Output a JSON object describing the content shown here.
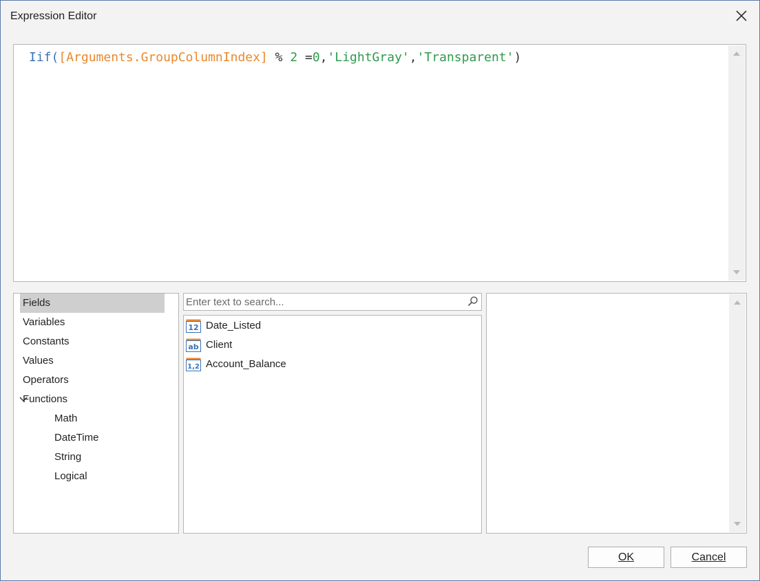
{
  "window": {
    "title": "Expression Editor"
  },
  "editor": {
    "tokens": {
      "fn": "Iif(",
      "field": "[Arguments.GroupColumnIndex]",
      "op1": " % ",
      "num1": "2",
      "op2": " =",
      "num2": "0",
      "comma1": ",",
      "str1": "'LightGray'",
      "comma2": ",",
      "str2": "'Transparent'",
      "close": ")"
    }
  },
  "categories": [
    {
      "label": "Fields",
      "selected": true
    },
    {
      "label": "Variables"
    },
    {
      "label": "Constants"
    },
    {
      "label": "Values"
    },
    {
      "label": "Operators"
    },
    {
      "label": "Functions",
      "expanded": true
    },
    {
      "label": "Math"
    },
    {
      "label": "DateTime"
    },
    {
      "label": "String"
    },
    {
      "label": "Logical"
    }
  ],
  "search": {
    "placeholder": "Enter text to search..."
  },
  "fields": [
    {
      "label": "Date_Listed",
      "icon_text": "12",
      "icon": "number-field-icon"
    },
    {
      "label": "Client",
      "icon_text": "ab",
      "icon": "string-field-icon"
    },
    {
      "label": "Account_Balance",
      "icon_text": "1,2",
      "icon": "decimal-field-icon"
    }
  ],
  "buttons": {
    "ok": "OK",
    "cancel": "Cancel"
  },
  "colors": {
    "function": "#3a72b8",
    "field": "#e8892f",
    "literal": "#2f9a4c",
    "border": "#5b7aa8"
  }
}
